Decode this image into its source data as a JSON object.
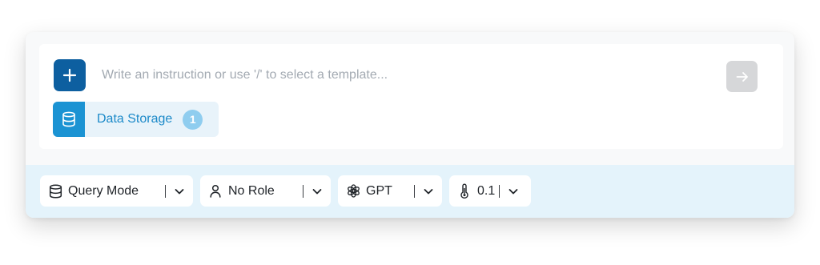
{
  "prompt": {
    "placeholder": "Write an instruction or use '/' to select a template...",
    "value": ""
  },
  "buttons": {
    "add_icon": "plus-icon",
    "send_icon": "arrow-right-icon"
  },
  "attachment_chip": {
    "label": "Data Storage",
    "count": "1",
    "icon": "database-icon"
  },
  "toolbar": {
    "mode": {
      "label": "Query Mode",
      "icon": "database-icon"
    },
    "role": {
      "label": "No Role",
      "icon": "user-icon"
    },
    "model": {
      "label": "GPT",
      "icon": "openai-icon"
    },
    "temperature": {
      "label": "0.1",
      "icon": "thermometer-icon"
    }
  },
  "colors": {
    "primary": "#0d5fa0",
    "accent": "#1b93d3",
    "chip_bg": "#e8f3fa",
    "toolbar_bg": "#e4f3fb",
    "send_disabled": "#d6d7d9"
  }
}
